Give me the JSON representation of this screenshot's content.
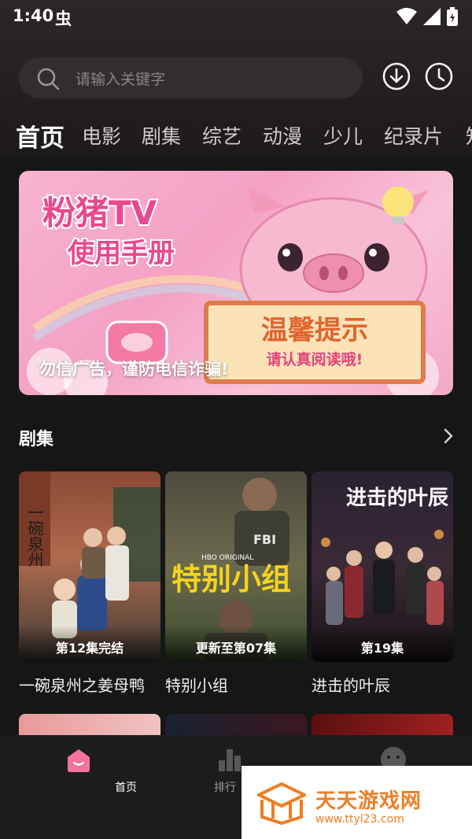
{
  "status": {
    "time": "1:40",
    "notif_glyph": "虫"
  },
  "search": {
    "placeholder": "请输入关键字"
  },
  "tabs": [
    "首页",
    "电影",
    "剧集",
    "综艺",
    "动漫",
    "少儿",
    "纪录片",
    "知"
  ],
  "active_tab": 0,
  "banner": {
    "art_title_line1": "粉猪TV",
    "art_title_line2": "使用手册",
    "art_sign_main": "温馨提示",
    "art_sign_sub": "请认真阅读哦!",
    "caption": "勿信广告，谨防电信诈骗!"
  },
  "section": {
    "title": "剧集",
    "more_icon": "chevron-right-icon"
  },
  "cards": [
    {
      "title": "一碗泉州之姜母鸭",
      "badge": "第12集完结",
      "poster_text": "一碗泉州"
    },
    {
      "title": "特别小组",
      "badge": "更新至第07集",
      "poster_text": "特别小组",
      "poster_tag": "HBO ORIGINAL",
      "vest_text": "FBI"
    },
    {
      "title": "进击的叶辰",
      "badge": "第19集",
      "poster_text": "进击的叶辰"
    }
  ],
  "bottom_nav": [
    {
      "label": "首页",
      "icon": "home-icon"
    },
    {
      "label": "排行",
      "icon": "ranking-icon"
    },
    {
      "label": "",
      "icon": "profile-icon"
    }
  ],
  "watermark": {
    "name": "天天游戏网",
    "url": "www.ttyl23.com"
  },
  "colors": {
    "accent_pink": "#f472a0",
    "watermark_orange": "#ef7d22",
    "background": "#161616"
  }
}
